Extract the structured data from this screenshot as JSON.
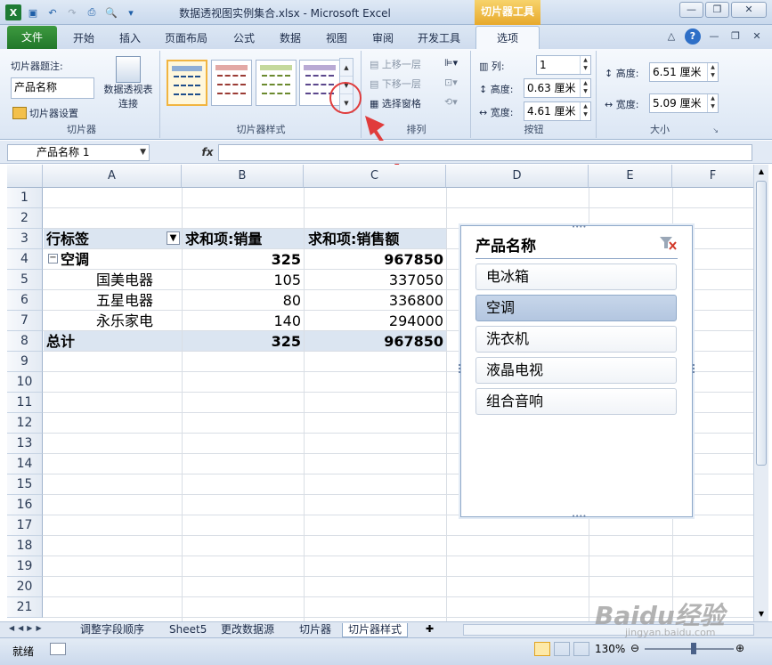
{
  "window": {
    "title": "数据透视图实例集合.xlsx  -  Microsoft Excel",
    "context_tab_title": "切片器工具"
  },
  "ribbon_tabs": [
    "文件",
    "开始",
    "插入",
    "页面布局",
    "公式",
    "数据",
    "视图",
    "审阅",
    "开发工具",
    "选项"
  ],
  "ribbon": {
    "slicer_group": {
      "caption_label": "切片器题注:",
      "caption_value": "产品名称",
      "settings_label": "切片器设置",
      "pivot_connections_label": "数据透视表\n连接",
      "group_label": "切片器"
    },
    "styles_group": {
      "group_label": "切片器样式"
    },
    "arrange_group": {
      "bring_forward": "上移一层",
      "send_backward": "下移一层",
      "selection_pane": "选择窗格",
      "group_label": "排列"
    },
    "buttons_group": {
      "columns_label": "列:",
      "columns_value": "1",
      "height_label": "高度:",
      "height_value": "0.63 厘米",
      "width_label": "宽度:",
      "width_value": "4.61 厘米",
      "group_label": "按钮"
    },
    "size_group": {
      "height_label": "高度:",
      "height_value": "6.51 厘米",
      "width_label": "宽度:",
      "width_value": "5.09 厘米",
      "group_label": "大小"
    }
  },
  "formula_bar": {
    "name_box": "产品名称  1",
    "fx": "fx",
    "formula": ""
  },
  "columns": [
    "A",
    "B",
    "C",
    "D",
    "E",
    "F"
  ],
  "rows": [
    "1",
    "2",
    "3",
    "4",
    "5",
    "6",
    "7",
    "8",
    "9",
    "10",
    "11",
    "12",
    "13",
    "14",
    "15",
    "16",
    "17",
    "18",
    "19",
    "20",
    "21"
  ],
  "pivot": {
    "row_label_header": "行标签",
    "col1_header": "求和项:销量",
    "col2_header": "求和项:销售额",
    "group_label": "空调",
    "group_qty": "325",
    "group_amount": "967850",
    "items": [
      {
        "name": "国美电器",
        "qty": "105",
        "amount": "337050"
      },
      {
        "name": "五星电器",
        "qty": "80",
        "amount": "336800"
      },
      {
        "name": "永乐家电",
        "qty": "140",
        "amount": "294000"
      }
    ],
    "total_label": "总计",
    "total_qty": "325",
    "total_amount": "967850"
  },
  "slicer": {
    "title": "产品名称",
    "items": [
      "电冰箱",
      "空调",
      "洗衣机",
      "液晶电视",
      "组合音响"
    ],
    "selected_index": 1
  },
  "sheet_tabs": [
    "调整字段顺序",
    "Sheet5",
    "更改数据源",
    "切片器",
    "切片器样式"
  ],
  "active_sheet_index": 4,
  "status": {
    "ready": "就绪",
    "zoom": "130%"
  },
  "watermark": {
    "brand": "Baidu经验",
    "url": "jingyan.baidu.com"
  },
  "colors": {
    "accent": "#21772a",
    "slicer_selected": "#b3c6e0",
    "annotation": "#e03c3c"
  }
}
